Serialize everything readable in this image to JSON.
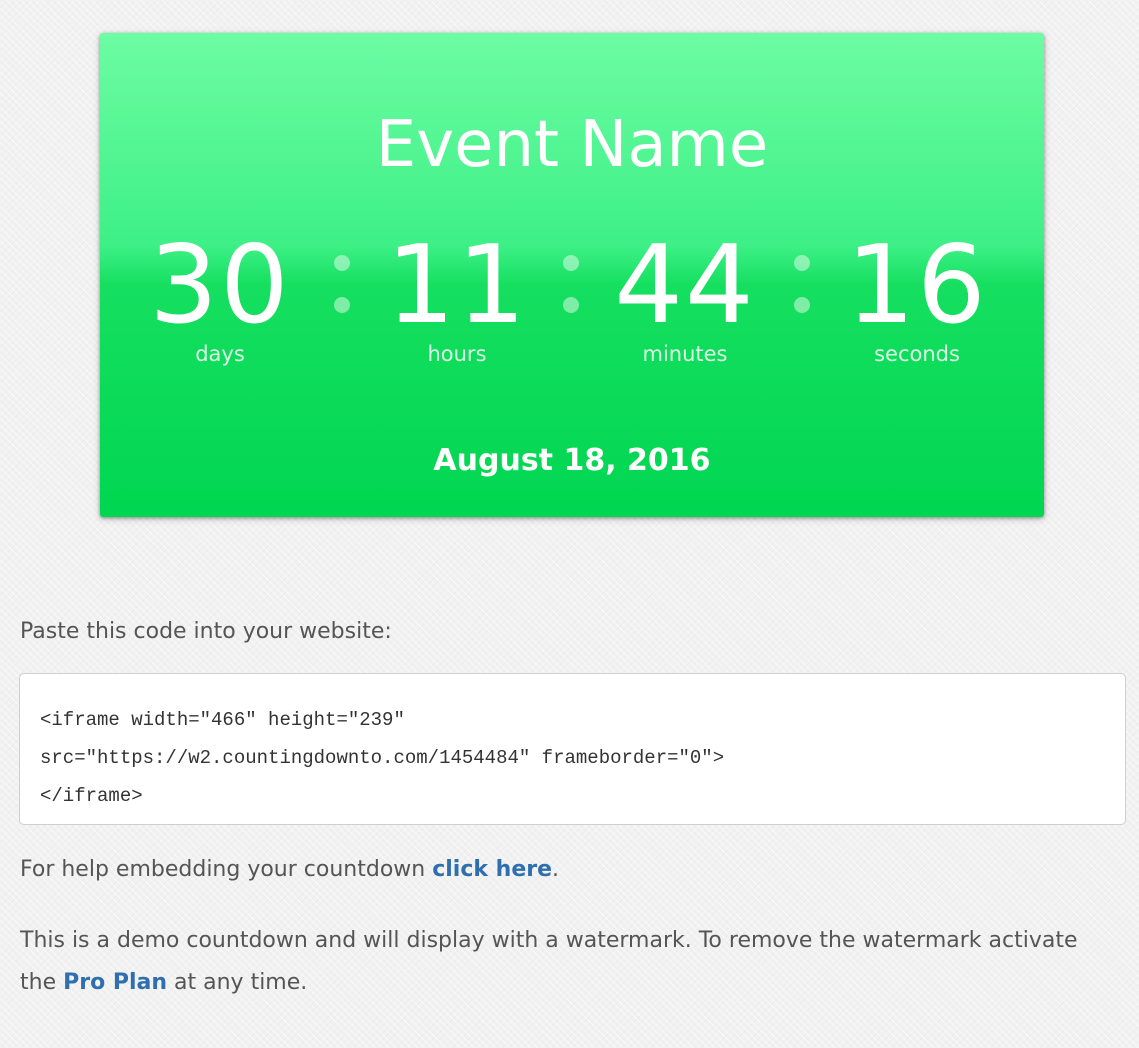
{
  "countdown": {
    "title": "Event Name",
    "days": {
      "value": "30",
      "label": "days"
    },
    "hours": {
      "value": "11",
      "label": "hours"
    },
    "minutes": {
      "value": "44",
      "label": "minutes"
    },
    "seconds": {
      "value": "16",
      "label": "seconds"
    },
    "date": "August 18, 2016",
    "colors": {
      "background_top": "#6dfca3",
      "background_bottom": "#00d651",
      "text": "#ffffff"
    }
  },
  "embed": {
    "prompt": "Paste this code into your website:",
    "code": "<iframe width=\"466\" height=\"239\"\nsrc=\"https://w2.countingdownto.com/1454484\" frameborder=\"0\">\n</iframe>",
    "help_prefix": "For help embedding your countdown ",
    "help_link": "click here",
    "help_suffix": ".",
    "demo_prefix": "This is a demo countdown and will display with a watermark. To remove the watermark activate the ",
    "pro_link": "Pro Plan",
    "demo_suffix": " at any time.",
    "link_color": "#2f6fae"
  }
}
